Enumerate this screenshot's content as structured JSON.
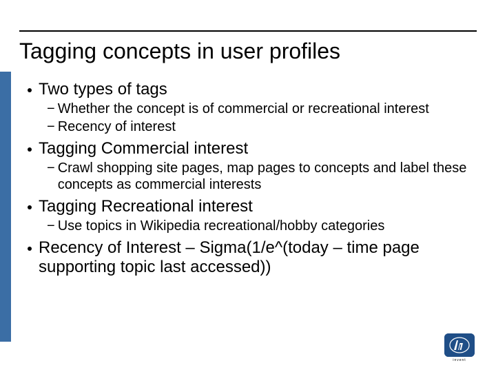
{
  "title": "Tagging concepts in user profiles",
  "bullets": [
    {
      "text": "Two types of tags",
      "sub": [
        "Whether the concept is of commercial or recreational interest",
        "Recency of interest"
      ]
    },
    {
      "text": "Tagging Commercial interest",
      "sub": [
        "Crawl shopping site pages, map pages to concepts and label these concepts as commercial interests"
      ]
    },
    {
      "text": "Tagging Recreational interest",
      "sub": [
        "Use topics in Wikipedia recreational/hobby categories"
      ]
    },
    {
      "text": "Recency of Interest – Sigma(1/e^(today – time page supporting topic last accessed))",
      "sub": []
    }
  ],
  "logo": {
    "brand": "hp",
    "sub": "invent"
  }
}
